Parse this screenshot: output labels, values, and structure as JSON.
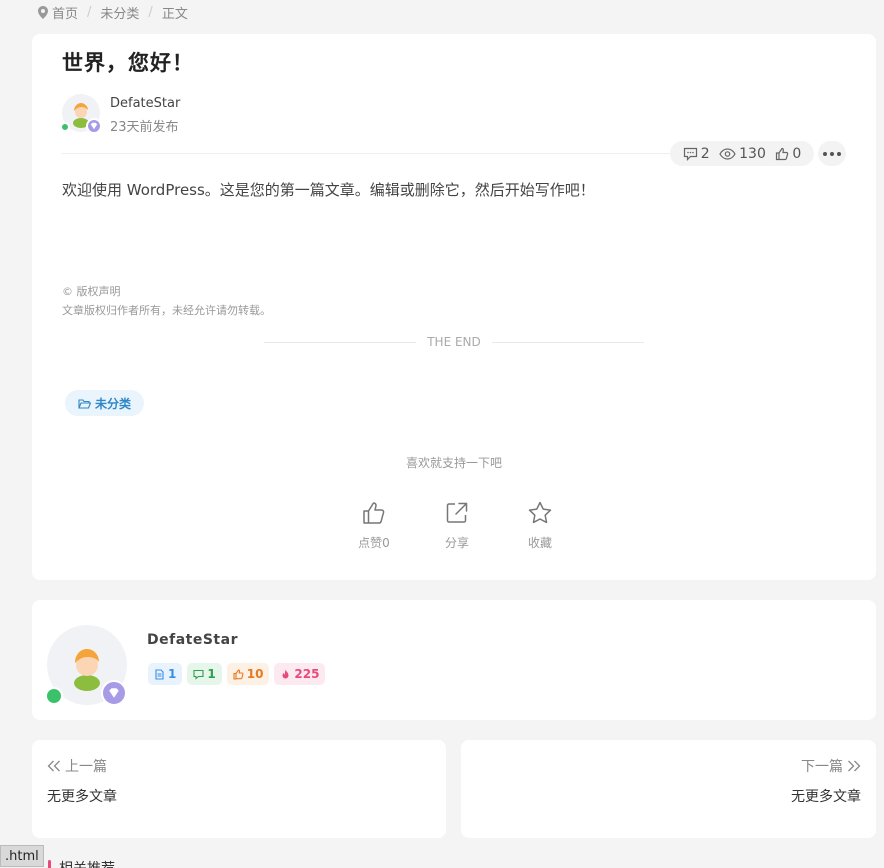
{
  "breadcrumb": {
    "home": "首页",
    "category": "未分类",
    "current": "正文"
  },
  "article": {
    "title": "世界，您好！",
    "author": "DefateStar",
    "published": "23天前发布",
    "stats": {
      "comments": "2",
      "views": "130",
      "likes": "0"
    },
    "content": "欢迎使用 WordPress。这是您的第一篇文章。编辑或删除它，然后开始写作吧！",
    "copyright_title": "© 版权声明",
    "copyright_text": "文章版权归作者所有，未经允许请勿转载。",
    "the_end": "THE END",
    "tag": "未分类",
    "support_text": "喜欢就支持一下吧",
    "actions": {
      "like": "点赞0",
      "share": "分享",
      "favorite": "收藏"
    }
  },
  "author_card": {
    "name": "DefateStar",
    "badges": {
      "posts": "1",
      "comments": "1",
      "likes": "10",
      "hot": "225"
    }
  },
  "post_nav": {
    "prev_label": "上一篇",
    "prev_title": "无更多文章",
    "next_label": "下一篇",
    "next_title": "无更多文章"
  },
  "related_title": "相关推荐",
  "status_filename": ".html",
  "colors": {
    "online": "#3cc16b",
    "tag_blue": "#2f86c8",
    "accent_pink": "#e84a7a"
  }
}
